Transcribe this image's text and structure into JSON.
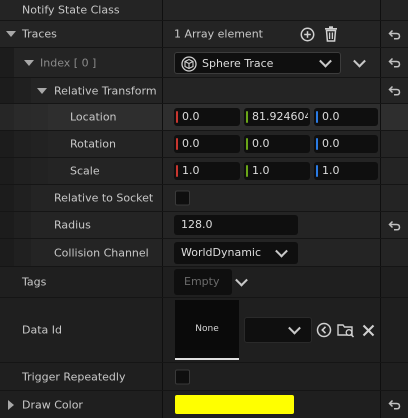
{
  "header": {
    "label": "Notify State Class"
  },
  "traces": {
    "label": "Traces",
    "count_text": "1 Array element",
    "index_label": "Index [ 0 ]",
    "trace_type": "Sphere Trace"
  },
  "relative_transform": {
    "label": "Relative Transform",
    "location": {
      "label": "Location",
      "x": "0.0",
      "y": "81.924604",
      "z": "0.0"
    },
    "rotation": {
      "label": "Rotation",
      "x": "0.0",
      "y": "0.0",
      "z": "0.0"
    },
    "scale": {
      "label": "Scale",
      "x": "1.0",
      "y": "1.0",
      "z": "1.0"
    }
  },
  "relative_to_socket": {
    "label": "Relative to Socket"
  },
  "radius": {
    "label": "Radius",
    "value": "128.0"
  },
  "collision_channel": {
    "label": "Collision Channel",
    "value": "WorldDynamic"
  },
  "tags": {
    "label": "Tags",
    "placeholder": "Empty"
  },
  "data_id": {
    "label": "Data Id",
    "thumbnail_text": "None"
  },
  "trigger_repeatedly": {
    "label": "Trigger Repeatedly"
  },
  "draw_color": {
    "label": "Draw Color",
    "color": "#ffff00"
  },
  "colors": {
    "x_axis": "#c8362f",
    "y_axis": "#6aa618",
    "z_axis": "#2a7be4",
    "draw_color": "#ffff00"
  }
}
